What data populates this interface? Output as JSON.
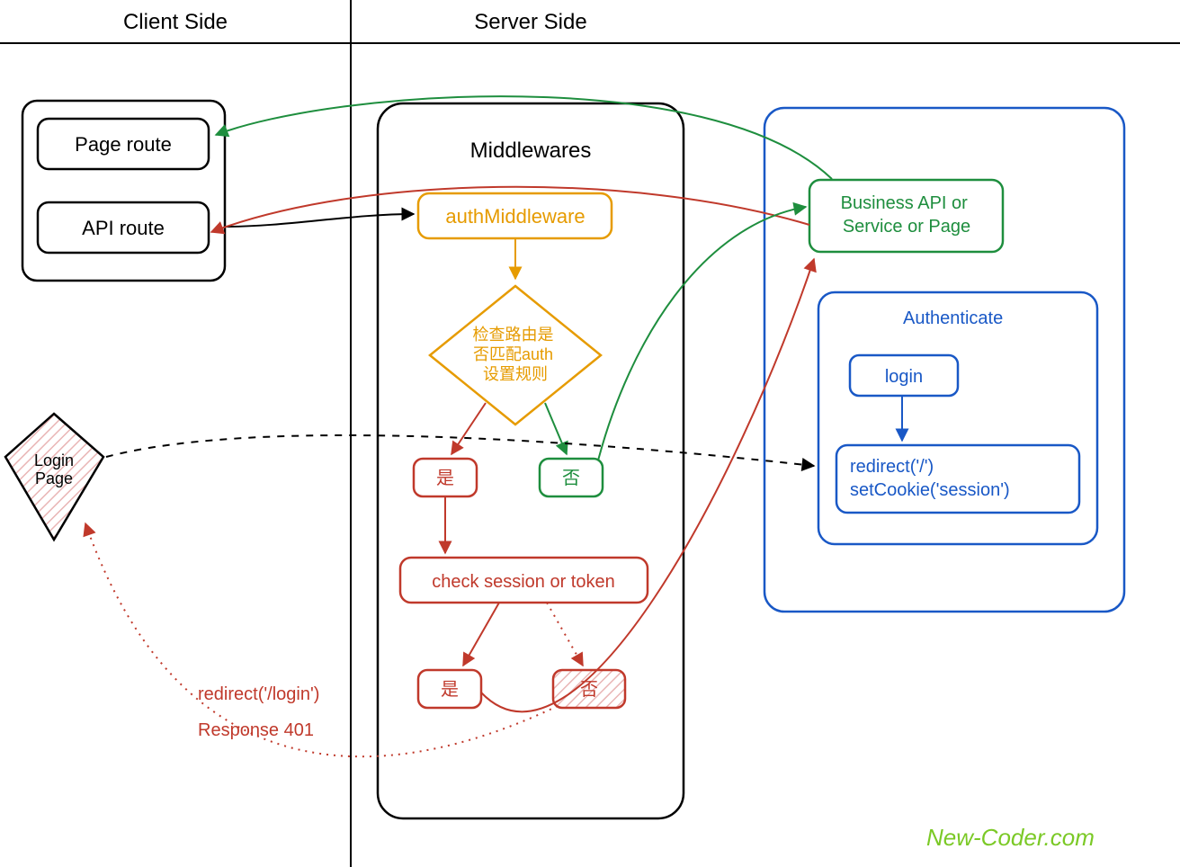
{
  "headers": {
    "client": "Client Side",
    "server": "Server Side"
  },
  "client": {
    "page_route": "Page route",
    "api_route": "API route",
    "login_page": "Login\nPage"
  },
  "middlewares": {
    "title": "Middlewares",
    "auth_mw": "authMiddleware",
    "check_route": "检查路由是\n否匹配auth\n设置规则",
    "yes1": "是",
    "no1": "否",
    "check_session": "check session or token",
    "yes2": "是",
    "no2": "否"
  },
  "business": {
    "title": "Business API or\nService or Page"
  },
  "auth": {
    "title": "Authenticate",
    "login": "login",
    "redirect": "redirect('/')\nsetCookie('session')"
  },
  "labels": {
    "redirect_login": "redirect('/login')",
    "resp_401": "Response 401"
  },
  "watermark": "New-Coder.com",
  "colors": {
    "black": "#000000",
    "orange": "#e69b00",
    "red": "#c0392b",
    "green": "#1e8e3e",
    "blue": "#1958c6",
    "lime": "#7bc926",
    "hatch": "#f7d7d7"
  }
}
